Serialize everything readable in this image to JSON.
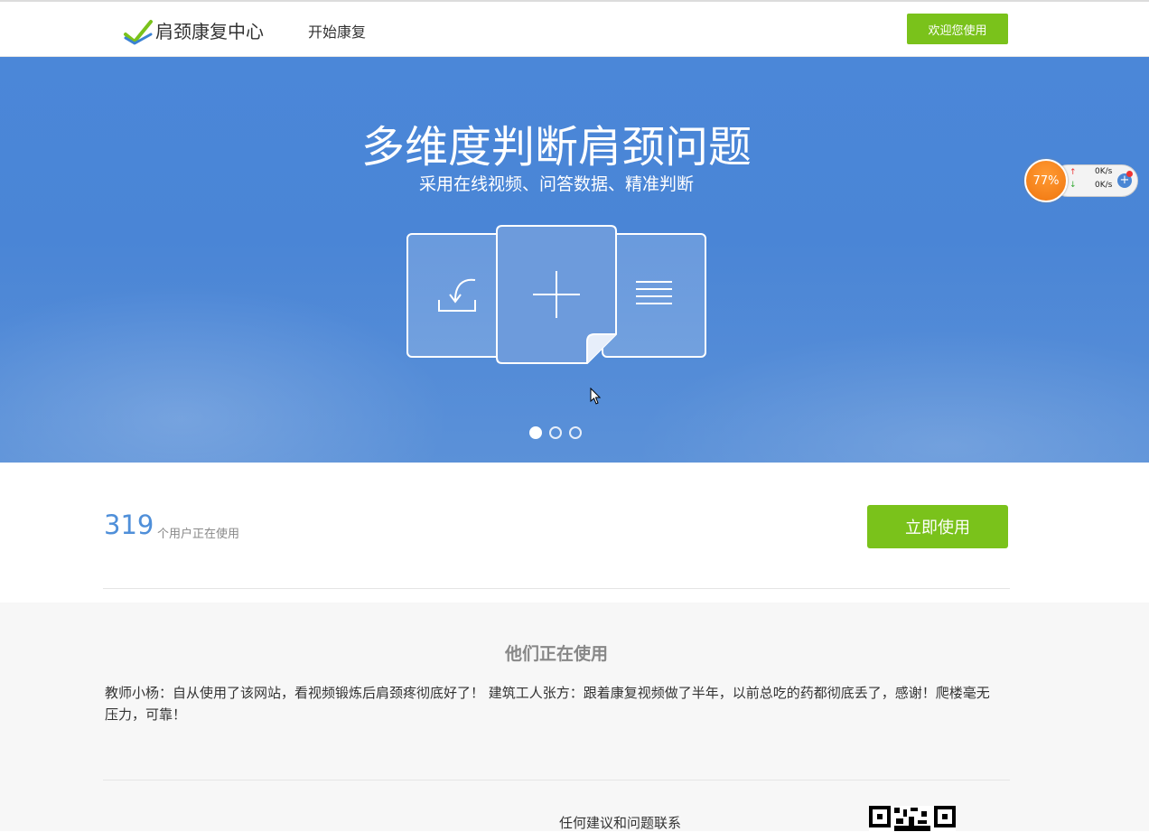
{
  "header": {
    "logo_text": "肩颈康复中心",
    "nav": {
      "start_label": "开始康复"
    },
    "welcome_button": "欢迎您使用"
  },
  "hero": {
    "title": "多维度判断肩颈问题",
    "subtitle": "采用在线视频、问答数据、精准判断",
    "carousel": {
      "slides": 3,
      "active": 1
    }
  },
  "widget": {
    "percent": "77%",
    "upload_speed": "0K/s",
    "download_speed": "0K/s"
  },
  "stats": {
    "count": "319",
    "count_label": "个用户正在使用",
    "cta_button": "立即使用"
  },
  "testimonials": {
    "title": "他们正在使用",
    "text": "教师小杨：自从使用了该网站，看视频锻炼后肩颈疼彻底好了！ 建筑工人张方：跟着康复视频做了半年，以前总吃的药都彻底丢了，感谢！爬楼毫无压力，可靠！"
  },
  "footer": {
    "contact_label": "任何建议和问题联系"
  },
  "colors": {
    "brand_green": "#7ac21b",
    "hero_blue": "#4a85d6",
    "count_blue": "#4f8fd9"
  }
}
